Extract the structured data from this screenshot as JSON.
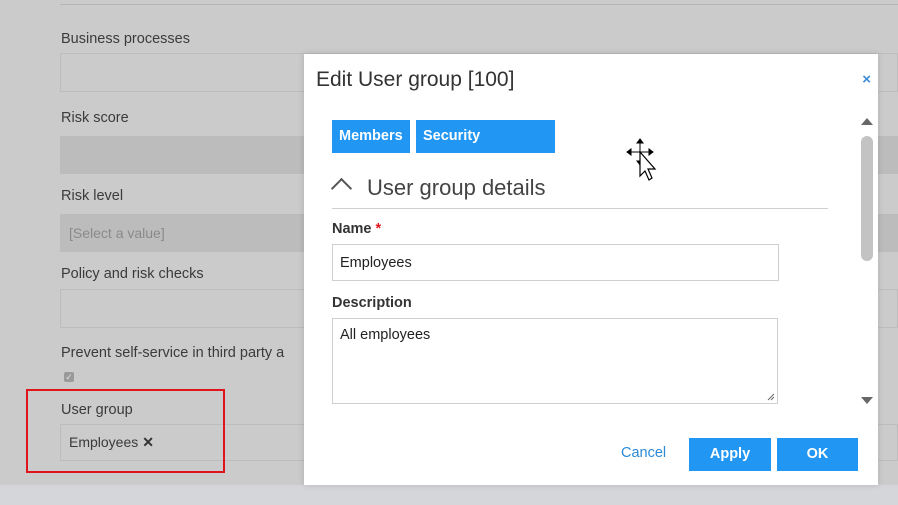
{
  "background": {
    "fields": [
      {
        "label": "Business processes"
      },
      {
        "label": "Risk score"
      },
      {
        "label": "Risk level",
        "placeholder": "[Select a value]"
      },
      {
        "label": "Policy and risk checks"
      },
      {
        "label": "Prevent self-service in third party a"
      }
    ],
    "user_group": {
      "label": "User group",
      "tag": "Employees",
      "remove_glyph": "✕"
    },
    "checkbox_glyph": "✓"
  },
  "modal": {
    "title": "Edit User group [100]",
    "close_glyph": "×",
    "tabs": [
      {
        "label": "Members"
      },
      {
        "label": "Security summary"
      }
    ],
    "section_title": "User group details",
    "name_label": "Name",
    "required_mark": "*",
    "name_value": "Employees",
    "description_label": "Description",
    "description_value": "All employees",
    "buttons": {
      "cancel": "Cancel",
      "apply": "Apply",
      "ok": "OK"
    }
  },
  "colors": {
    "accent": "#2196f3",
    "highlight": "#e0151c"
  },
  "icons": [
    "move-cursor-icon",
    "close-icon",
    "chevron-up-icon",
    "scroll-up-icon",
    "scroll-down-icon",
    "resize-handle-icon"
  ]
}
